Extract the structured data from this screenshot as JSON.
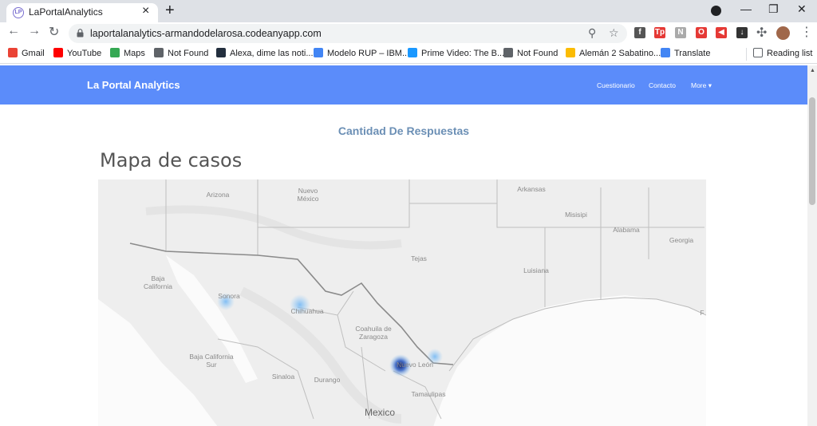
{
  "browser": {
    "tab_title": "LaPortalAnalytics",
    "tab_favicon_text": "LP",
    "url": "laportalanalytics-armandodelarosa.codeanyapp.com",
    "bookmarks": [
      {
        "label": "Gmail",
        "icon": "gmail-icon",
        "color": "#ea4335"
      },
      {
        "label": "YouTube",
        "icon": "youtube-icon",
        "color": "#ff0000"
      },
      {
        "label": "Maps",
        "icon": "maps-icon",
        "color": "#34a853"
      },
      {
        "label": "Not Found",
        "icon": "globe-icon",
        "color": "#5f6368"
      },
      {
        "label": "Alexa, dime las noti...",
        "icon": "amazon-icon",
        "color": "#232f3e"
      },
      {
        "label": "Modelo RUP – IBM...",
        "icon": "google-icon",
        "color": "#4285f4"
      },
      {
        "label": "Prime Video: The B...",
        "icon": "prime-video-icon",
        "color": "#1a98ff"
      },
      {
        "label": "Not Found",
        "icon": "globe-icon",
        "color": "#5f6368"
      },
      {
        "label": "Alemán 2 Sabatino...",
        "icon": "drive-icon",
        "color": "#fbbc04"
      },
      {
        "label": "Translate",
        "icon": "translate-icon",
        "color": "#4285f4"
      }
    ],
    "reading_list": "Reading list",
    "extensions": [
      {
        "icon": "facebook-ext-icon",
        "text": "f",
        "color": "#555"
      },
      {
        "icon": "tp-ext-icon",
        "text": "Tp",
        "color": "#e53935"
      },
      {
        "icon": "gray-ext-icon",
        "text": "N",
        "color": "#aaa"
      },
      {
        "icon": "opera-ext-icon",
        "text": "O",
        "color": "#e53935"
      },
      {
        "icon": "megaphone-ext-icon",
        "text": "◀",
        "color": "#e53935"
      },
      {
        "icon": "download-ext-icon",
        "text": "↓",
        "color": "#333"
      }
    ]
  },
  "site": {
    "brand": "La Portal Analytics",
    "nav": [
      "Cuestionario",
      "Contacto",
      "More"
    ],
    "nav_color": "#5b8cfa",
    "section_title": "Cantidad De Respuestas",
    "map_title": "Mapa de casos"
  },
  "map": {
    "labels": [
      {
        "text": "Arizona",
        "lines": [
          "Arizona"
        ]
      },
      {
        "text": "Nuevo México",
        "lines": [
          "Nuevo",
          "México"
        ]
      },
      {
        "text": "Arkansas",
        "lines": [
          "Arkansas"
        ]
      },
      {
        "text": "Misisipi",
        "lines": [
          "Misisipi"
        ]
      },
      {
        "text": "Alabama",
        "lines": [
          "Alabama"
        ]
      },
      {
        "text": "Georgia",
        "lines": [
          "Georgia"
        ]
      },
      {
        "text": "Tejas",
        "lines": [
          "Tejas"
        ]
      },
      {
        "text": "Luisiana",
        "lines": [
          "Luisiana"
        ]
      },
      {
        "text": "Baja California",
        "lines": [
          "Baja",
          "California"
        ]
      },
      {
        "text": "Sonora",
        "lines": [
          "Sonora"
        ]
      },
      {
        "text": "Chihuahua",
        "lines": [
          "Chihuahua"
        ]
      },
      {
        "text": "Coahuila de Zaragoza",
        "lines": [
          "Coahuila de",
          "Zaragoza"
        ]
      },
      {
        "text": "Nuevo León",
        "lines": [
          "Nuevo León"
        ]
      },
      {
        "text": "Baja California Sur",
        "lines": [
          "Baja California",
          "Sur"
        ]
      },
      {
        "text": "Sinaloa",
        "lines": [
          "Sinaloa"
        ]
      },
      {
        "text": "Durango",
        "lines": [
          "Durango"
        ]
      },
      {
        "text": "Tamaulipas",
        "lines": [
          "Tamaulipas"
        ]
      },
      {
        "text": "Mexico",
        "lines": [
          "Mexico"
        ]
      },
      {
        "text": "F",
        "lines": [
          "F"
        ]
      }
    ],
    "hotspots": [
      {
        "place": "Sonora",
        "intensity": 0.3
      },
      {
        "place": "Chihuahua",
        "intensity": 0.5
      },
      {
        "place": "Nuevo León",
        "intensity": 1.0
      },
      {
        "place": "Tamaulipas",
        "intensity": 0.3
      }
    ]
  }
}
